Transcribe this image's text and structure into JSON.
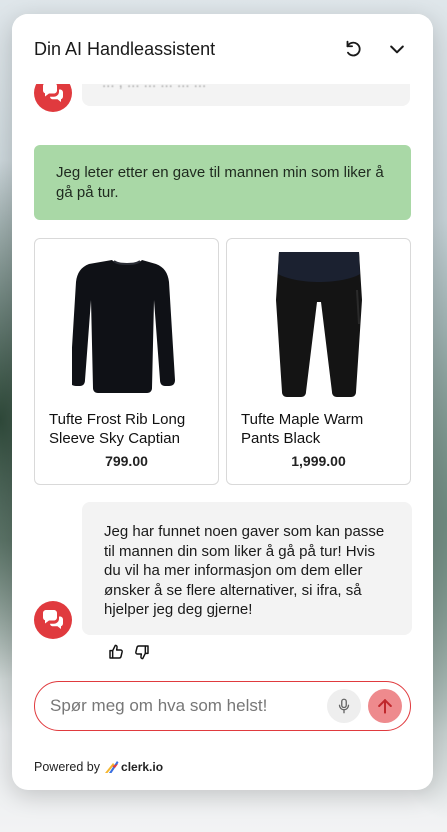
{
  "header": {
    "title": "Din AI Handleassistent",
    "reset_icon": "refresh-icon",
    "collapse_icon": "chevron-down-icon"
  },
  "messages": {
    "partial_bot_text": "... , ... ... ... ... ...",
    "user_text": "Jeg leter etter en gave til mannen min som liker å gå på tur.",
    "products": [
      {
        "name": "Tufte Frost Rib Long Sleeve Sky Captian",
        "price": "799.00"
      },
      {
        "name": "Tufte Maple Warm Pants Black",
        "price": "1,999.00"
      }
    ],
    "bot_reply": "Jeg har funnet noen gaver som kan passe til mannen din som liker å gå på tur! Hvis du vil ha mer informasjon om dem eller ønsker å se flere alternativer, si ifra, så hjelper jeg deg gjerne!"
  },
  "input": {
    "placeholder": "Spør meg om hva som helst!",
    "value": ""
  },
  "footer": {
    "powered_by": "Powered by",
    "brand": "clerk.io"
  },
  "colors": {
    "accent": "#e03a3e",
    "user_bubble": "#a9d8a6",
    "bot_bubble": "#f3f3f3",
    "send_button": "#ee8a8d"
  }
}
